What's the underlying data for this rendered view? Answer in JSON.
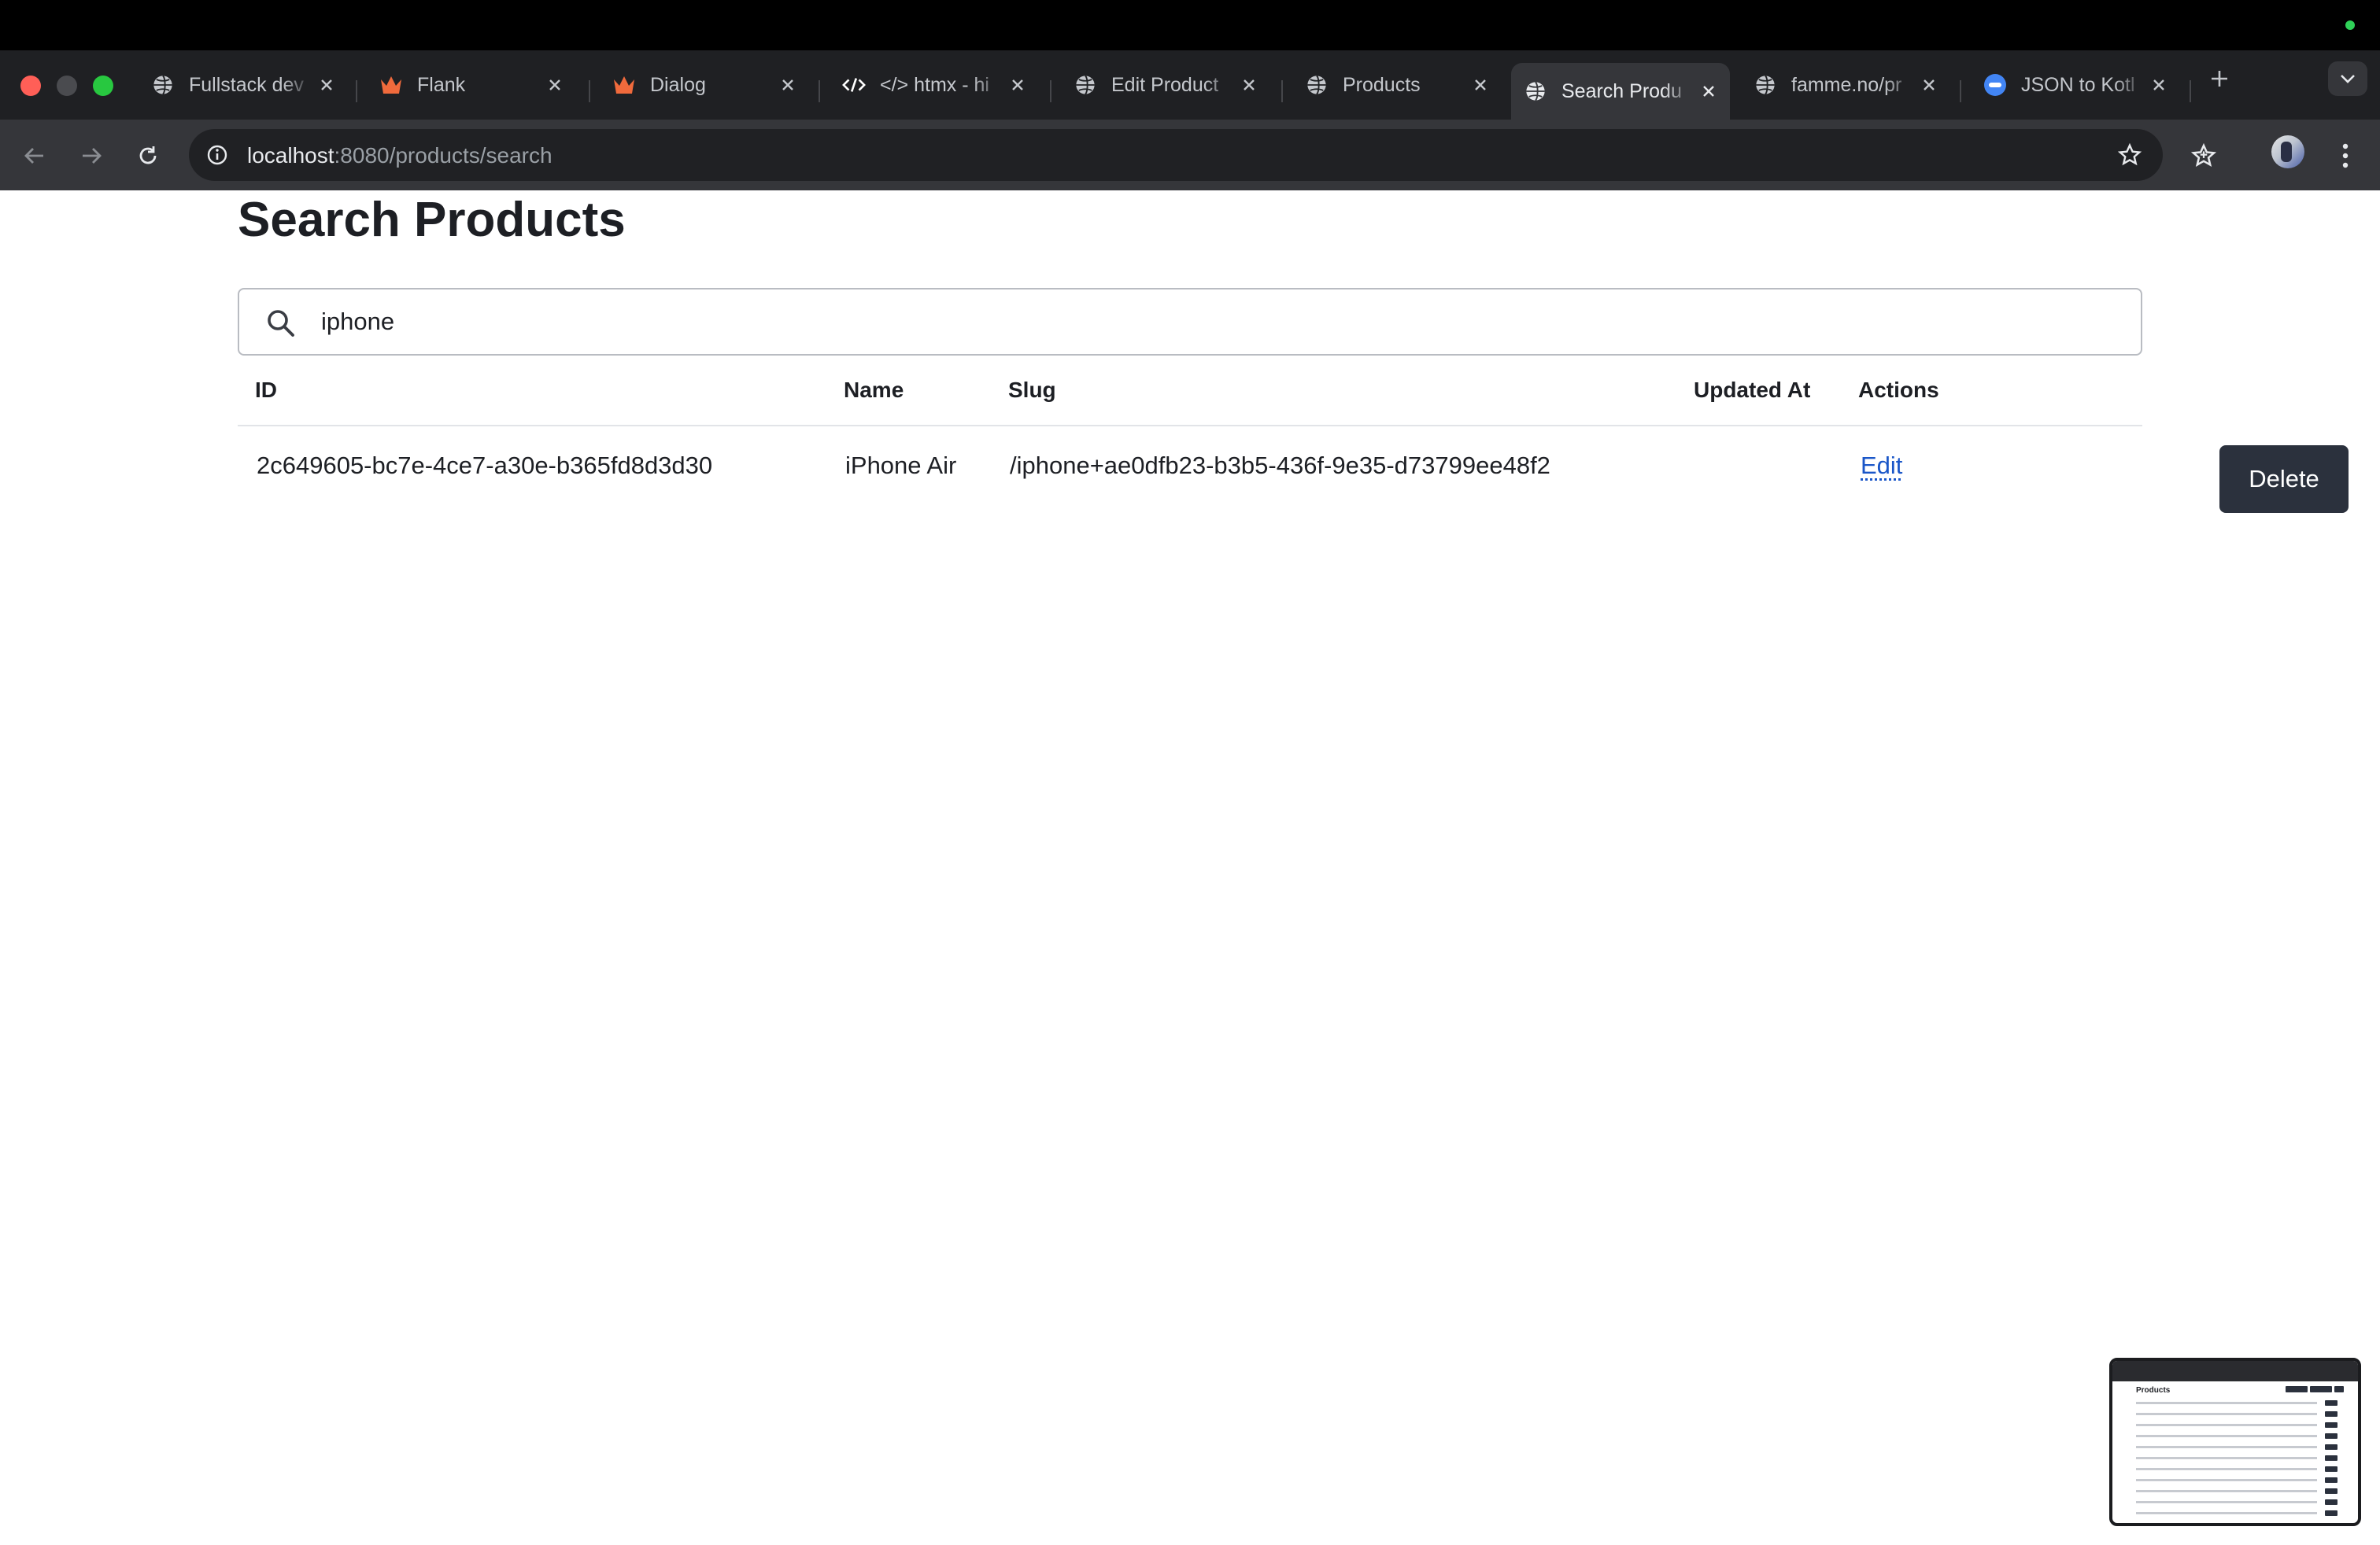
{
  "browser": {
    "tabs": [
      {
        "title": "Fullstack dev",
        "icon": "globe-icon",
        "active": false
      },
      {
        "title": "Flank",
        "icon": "crown-icon",
        "active": false
      },
      {
        "title": "Dialog",
        "icon": "crown-icon",
        "active": false
      },
      {
        "title": "</> htmx - hi",
        "icon": "code-icon",
        "active": false
      },
      {
        "title": "Edit Product",
        "icon": "globe-icon",
        "active": false
      },
      {
        "title": "Products",
        "icon": "globe-icon",
        "active": false
      },
      {
        "title": "Search Produ",
        "icon": "globe-icon",
        "active": true
      },
      {
        "title": "famme.no/pr",
        "icon": "globe-icon",
        "active": false
      },
      {
        "title": "JSON to Kotl",
        "icon": "json-icon",
        "active": false
      }
    ],
    "address": {
      "host": "localhost",
      "rest": ":8080/products/search"
    }
  },
  "page": {
    "title": "Search Products",
    "search": {
      "value": "iphone"
    },
    "table": {
      "columns": [
        "ID",
        "Name",
        "Slug",
        "Updated At",
        "Actions"
      ],
      "rows": [
        {
          "id": "2c649605-bc7e-4ce7-a30e-b365fd8d3d30",
          "name": "iPhone Air",
          "slug": "/iphone+ae0dfb23-b3b5-436f-9e35-d73799ee48f2",
          "updated_at": "",
          "edit_label": "Edit",
          "delete_label": "Delete"
        }
      ]
    }
  },
  "thumbnail": {
    "title": "Products"
  },
  "colors": {
    "accent_link": "#1a56c8",
    "button_dark": "#2b313d",
    "chrome_dark": "#35363a"
  }
}
